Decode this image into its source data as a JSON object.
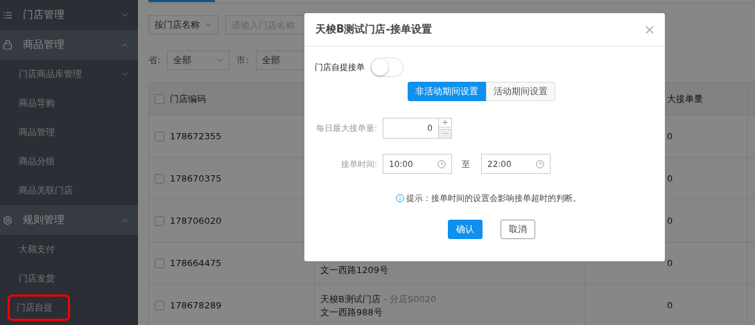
{
  "sidebar": {
    "groups": [
      {
        "label": "门店管理",
        "kind": "list",
        "expanded": false
      },
      {
        "label": "商品管理",
        "kind": "bag",
        "expanded": true,
        "children": [
          {
            "label": "门店商品库管理",
            "has_children": true,
            "annotated": false
          },
          {
            "label": "商品导购",
            "has_children": false,
            "annotated": false
          },
          {
            "label": "商品管理",
            "has_children": false,
            "annotated": false
          },
          {
            "label": "商品分组",
            "has_children": false,
            "annotated": false
          },
          {
            "label": "商品关联门店",
            "has_children": false,
            "annotated": false
          }
        ]
      },
      {
        "label": "规则管理",
        "kind": "gear",
        "expanded": true,
        "children": [
          {
            "label": "大额支付",
            "has_children": false,
            "annotated": false
          },
          {
            "label": "门店发货",
            "has_children": false,
            "annotated": false
          },
          {
            "label": "门店自提",
            "has_children": false,
            "annotated": true
          }
        ]
      }
    ]
  },
  "filters": {
    "search_by": "按门店名称",
    "search_placeholder": "请输入门店名称",
    "province": {
      "label": "省:",
      "value": "全部"
    },
    "city": {
      "label": "市:",
      "value": "全部"
    }
  },
  "table": {
    "header_checked": false,
    "column_1": "门店编码",
    "column_3": "大接单量",
    "rows": [
      {
        "checked": false,
        "code": "178672355",
        "column_3": "0"
      },
      {
        "checked": false,
        "code": "178670375",
        "column_3": "0"
      },
      {
        "checked": false,
        "code": "178706020",
        "column_3": "0"
      },
      {
        "checked": false,
        "code": "178664475",
        "address": "文一西路1209号",
        "column_3": "0"
      },
      {
        "checked": false,
        "code": "178678289",
        "name": "天梭B测试门店",
        "branch": " - 分店S0020",
        "address": "文一西路988号",
        "column_3": "0"
      }
    ]
  },
  "dialog": {
    "title": "天梭B测试门店-接单设置",
    "switch": {
      "label": "门店自提接单",
      "on": false
    },
    "segments": [
      {
        "label": "非活动期间设置",
        "selected": true
      },
      {
        "label": "活动期间设置",
        "selected": false
      }
    ],
    "daily_max": {
      "label": "每日最大接单量:",
      "value": "0",
      "plus": "+",
      "minus": "−"
    },
    "time": {
      "label": "接单时间:",
      "start": "10:00",
      "separator": "至",
      "end": "22:00"
    },
    "hint": "提示：接单时间的设置会影响接单超时的判断。",
    "buttons": [
      {
        "label": "确认",
        "kind": "primary"
      },
      {
        "label": "取消",
        "kind": "default"
      }
    ]
  }
}
